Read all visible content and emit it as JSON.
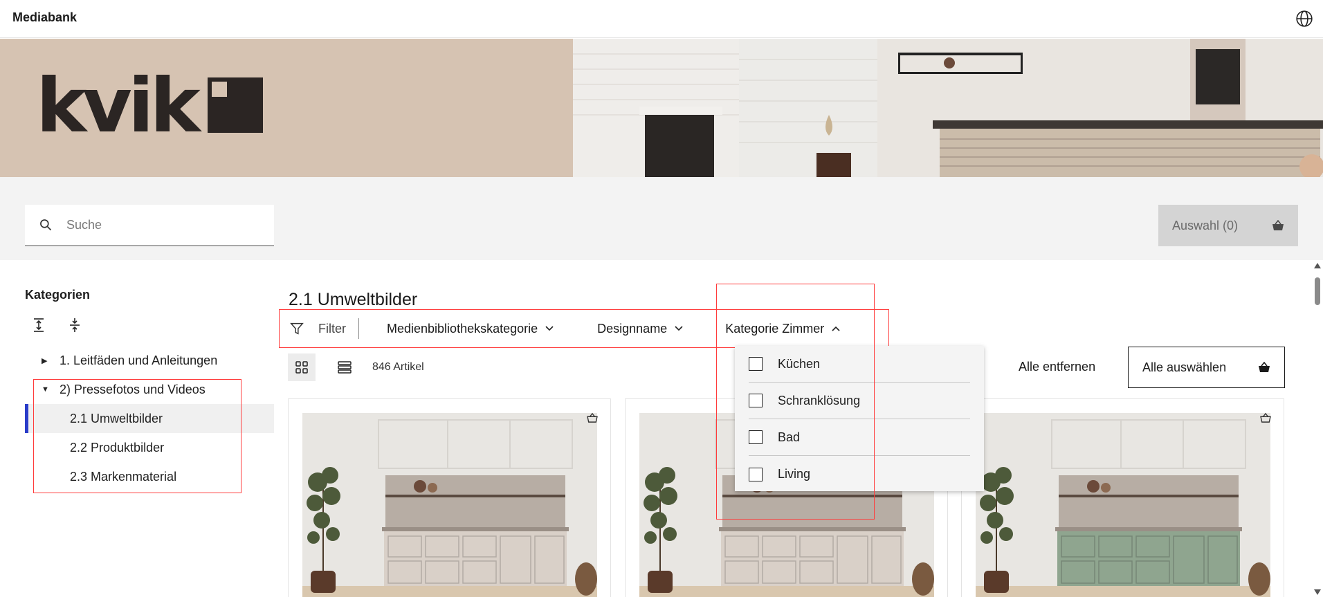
{
  "topbar": {
    "title": "Mediabank",
    "language_icon": "globe-icon"
  },
  "banner": {
    "brand": "kvik"
  },
  "search": {
    "placeholder": "Suche",
    "icon": "search-icon"
  },
  "selection": {
    "label": "Auswahl (0)",
    "icon": "basket-icon"
  },
  "sidebar": {
    "title": "Kategorien",
    "tools": [
      "expand-all-icon",
      "collapse-all-icon"
    ],
    "items": [
      {
        "label": "1. Leitfäden und Anleitungen",
        "expanded": false
      },
      {
        "label": "2) Pressefotos und Videos",
        "expanded": true
      },
      {
        "label": "2.1 Umweltbilder",
        "active": true
      },
      {
        "label": "2.2 Produktbilder"
      },
      {
        "label": "2.3 Markenmaterial"
      }
    ]
  },
  "main": {
    "title": "2.1 Umweltbilder",
    "filter": {
      "label": "Filter",
      "dropdowns": [
        "Medienbibliothekskategorie",
        "Designname",
        "Kategorie Zimmer"
      ]
    },
    "count": "846 Artikel",
    "remove_all": "Alle entfernen",
    "select_all": "Alle auswählen",
    "dropdown_options": [
      "Küchen",
      "Schranklösung",
      "Bad",
      "Living"
    ],
    "cards": [
      {
        "front_color": "#d9d0c8"
      },
      {
        "front_color": "#d9d0c8"
      },
      {
        "front_color": "#8fa58f"
      }
    ]
  }
}
